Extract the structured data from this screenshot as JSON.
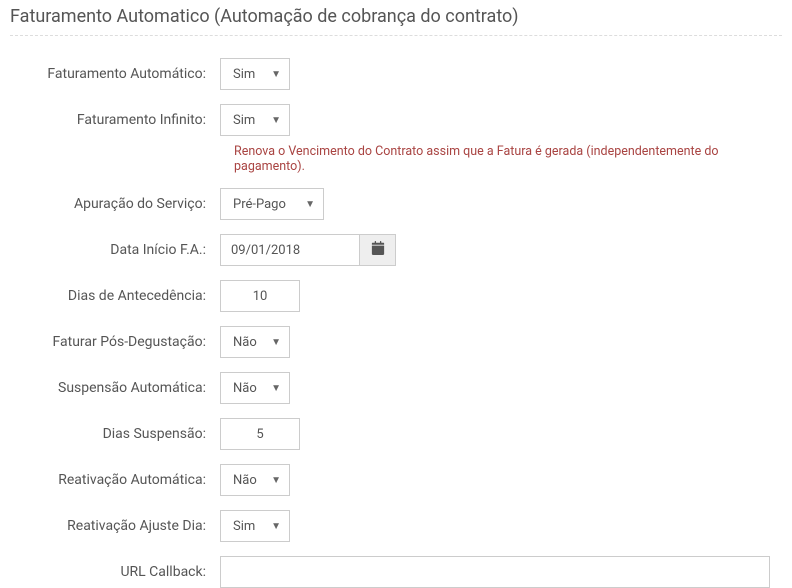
{
  "section": {
    "title": "Faturamento Automatico (Automação de cobrança do contrato)"
  },
  "fields": {
    "faturamento_automatico": {
      "label": "Faturamento Automático:",
      "value": "Sim"
    },
    "faturamento_infinito": {
      "label": "Faturamento Infinito:",
      "value": "Sim",
      "help": "Renova o Vencimento do Contrato assim que a Fatura é gerada (independentemente do pagamento)."
    },
    "apuracao_servico": {
      "label": "Apuração do Serviço:",
      "value": "Pré-Pago"
    },
    "data_inicio_fa": {
      "label": "Data Início F.A.:",
      "value": "09/01/2018"
    },
    "dias_antecedencia": {
      "label": "Dias de Antecedência:",
      "value": "10"
    },
    "faturar_pos_degustacao": {
      "label": "Faturar Pós-Degustação:",
      "value": "Não"
    },
    "suspensao_automatica": {
      "label": "Suspensão Automática:",
      "value": "Não"
    },
    "dias_suspensao": {
      "label": "Dias Suspensão:",
      "value": "5"
    },
    "reativacao_automatica": {
      "label": "Reativação Automática:",
      "value": "Não"
    },
    "reativacao_ajuste_dia": {
      "label": "Reativação Ajuste Dia:",
      "value": "Sim"
    },
    "url_callback": {
      "label": "URL Callback:",
      "value": ""
    }
  }
}
